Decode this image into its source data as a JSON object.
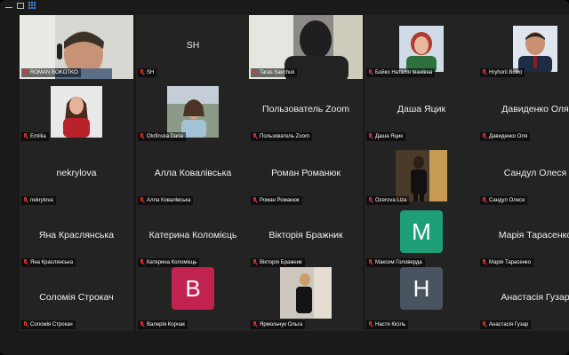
{
  "window": {
    "controls": [
      "minimize-icon",
      "restore-icon",
      "gallery-grid-icon"
    ]
  },
  "participants": [
    {
      "id": "p1",
      "tile_label": "ROMAN BOKOTKO",
      "display": "video",
      "active": true,
      "row": 0,
      "col": 0
    },
    {
      "id": "p2",
      "tile_label": "SH",
      "display": "text",
      "big_text": "SH",
      "row": 0,
      "col": 1
    },
    {
      "id": "p3",
      "tile_label": "Taras Savchuk",
      "display": "video",
      "row": 0,
      "col": 2
    },
    {
      "id": "p4",
      "tile_label": "Бойко Наталія Іванівна",
      "display": "photo",
      "row": 0,
      "col": 3
    },
    {
      "id": "p5",
      "tile_label": "Hryhorii Boiko",
      "display": "photo",
      "row": 0,
      "col": 4
    },
    {
      "id": "p6",
      "tile_label": "Emiliia",
      "display": "photo",
      "row": 1,
      "col": 0
    },
    {
      "id": "p7",
      "tile_label": "Olofinska Daria",
      "display": "photo",
      "row": 1,
      "col": 1
    },
    {
      "id": "p8",
      "tile_label": "Пользователь Zoom",
      "display": "text",
      "big_text": "Пользователь Zoom",
      "row": 1,
      "col": 2
    },
    {
      "id": "p9",
      "tile_label": "Даша Яцик",
      "display": "text",
      "big_text": "Даша Яцик",
      "row": 1,
      "col": 3
    },
    {
      "id": "p10",
      "tile_label": "Давиденко Оля",
      "display": "text",
      "big_text": "Давиденко Оля",
      "row": 1,
      "col": 4
    },
    {
      "id": "p11",
      "tile_label": "nekrylova",
      "display": "text",
      "big_text": "nekrylova",
      "row": 2,
      "col": 0
    },
    {
      "id": "p12",
      "tile_label": "Алла Ковалівська",
      "display": "text",
      "big_text": "Алла Ковалівська",
      "row": 2,
      "col": 1
    },
    {
      "id": "p13",
      "tile_label": "Роман Романюк",
      "display": "text",
      "big_text": "Роман Романюк",
      "row": 2,
      "col": 2
    },
    {
      "id": "p14",
      "tile_label": "Ozerova Liza",
      "display": "photo",
      "row": 2,
      "col": 3
    },
    {
      "id": "p15",
      "tile_label": "Сандул Олеся",
      "display": "text",
      "big_text": "Сандул Олеся",
      "row": 2,
      "col": 4
    },
    {
      "id": "p16",
      "tile_label": "Яна Краслянська",
      "display": "text",
      "big_text": "Яна Краслянська",
      "row": 3,
      "col": 0
    },
    {
      "id": "p17",
      "tile_label": "Катерина Коломієць",
      "display": "text",
      "big_text": "Катерина Коломієць",
      "row": 3,
      "col": 1
    },
    {
      "id": "p18",
      "tile_label": "Вікторія Бражник",
      "display": "text",
      "big_text": "Вікторія Бражник",
      "row": 3,
      "col": 2
    },
    {
      "id": "p19",
      "tile_label": "Максим Головерда",
      "display": "letter",
      "letter": "M",
      "letter_color": "#1f9e7a",
      "row": 3,
      "col": 3
    },
    {
      "id": "p20",
      "tile_label": "Марія Тарасенко",
      "display": "text",
      "big_text": "Марія Тарасенко",
      "row": 3,
      "col": 4
    },
    {
      "id": "p21",
      "tile_label": "Соломія Строкач",
      "display": "text",
      "big_text": "Соломія Строкач",
      "row": 4,
      "col": 0
    },
    {
      "id": "p22",
      "tile_label": "Валерія Корчак",
      "display": "letter",
      "letter": "B",
      "letter_color": "#c2224f",
      "row": 4,
      "col": 1
    },
    {
      "id": "p23",
      "tile_label": "Ярмольчук Ольга",
      "display": "photo",
      "row": 4,
      "col": 2
    },
    {
      "id": "p24",
      "tile_label": "Настя Кісіль",
      "display": "letter",
      "letter": "H",
      "letter_color": "#4a5360",
      "row": 4,
      "col": 3
    },
    {
      "id": "p25",
      "tile_label": "Анастасія Гузар",
      "display": "text",
      "big_text": "Анастасія Гузар",
      "row": 4,
      "col": 4
    }
  ],
  "colors": {
    "active_speaker_border": "#7bd35a",
    "muted_icon": "#e0322b",
    "tile_bg": "#232323",
    "window_bg": "#1a1a1a"
  }
}
